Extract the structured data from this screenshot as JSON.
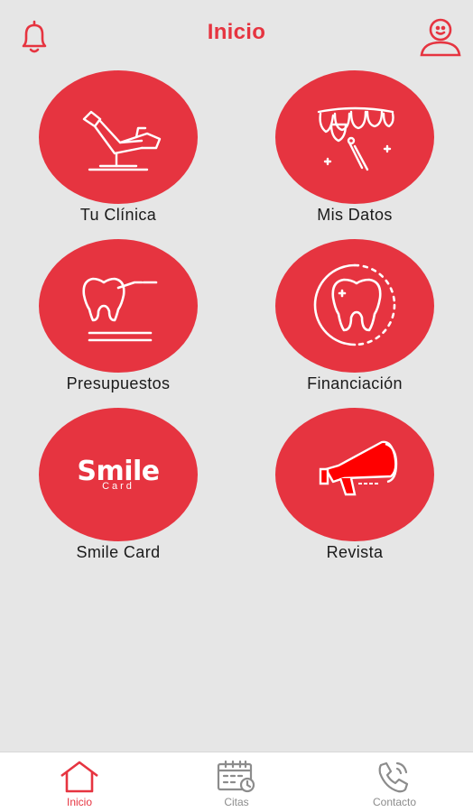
{
  "header": {
    "title": "Inicio"
  },
  "tiles": [
    {
      "label": "Tu Clínica"
    },
    {
      "label": "Mis Datos"
    },
    {
      "label": "Presupuestos"
    },
    {
      "label": "Financiación"
    },
    {
      "label": "Smile Card",
      "logo_main": "Smile",
      "logo_sub": "Card"
    },
    {
      "label": "Revista"
    }
  ],
  "bottom_nav": [
    {
      "label": "Inicio",
      "icon": "home-icon",
      "active": true
    },
    {
      "label": "Citas",
      "icon": "calendar-icon",
      "active": false
    },
    {
      "label": "Contacto",
      "icon": "phone-icon",
      "active": false
    }
  ],
  "colors": {
    "accent": "#e63440",
    "background": "#e6e6e6",
    "inactive": "#8c8c8c"
  }
}
